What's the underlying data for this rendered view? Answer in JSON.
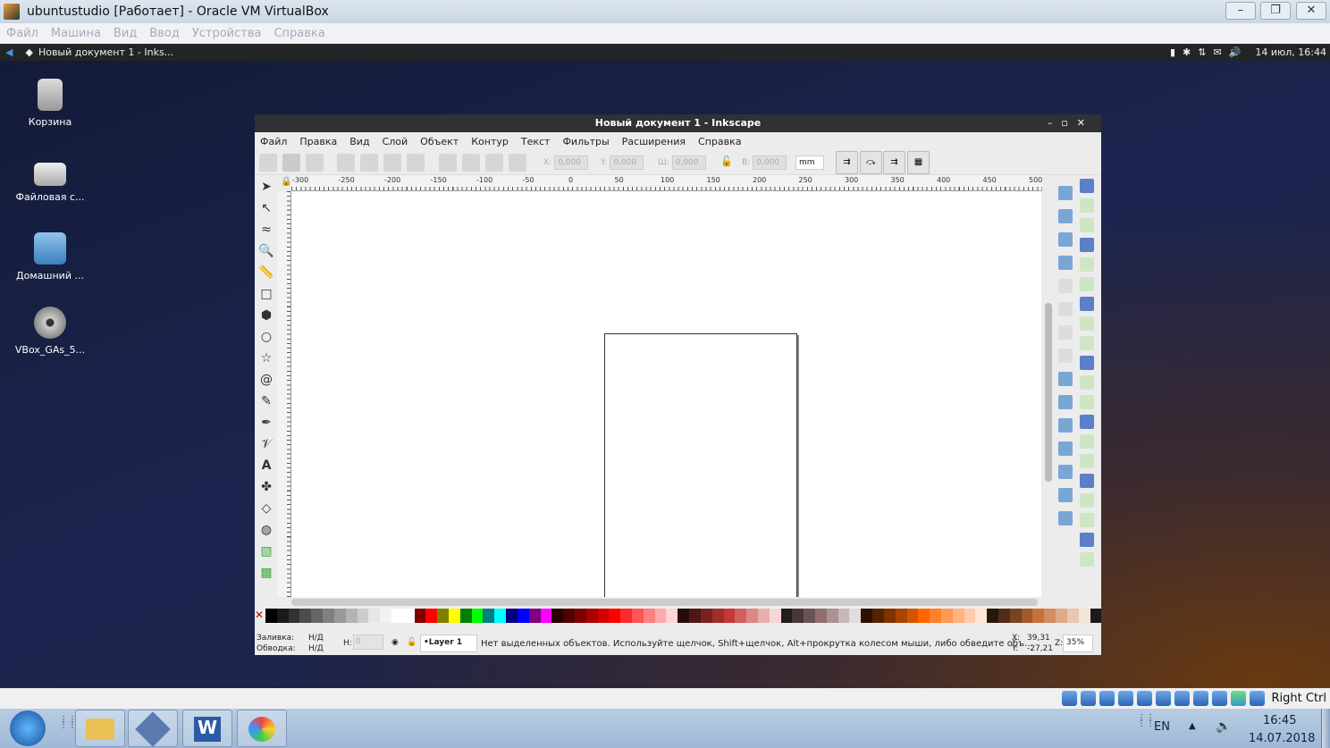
{
  "vbox": {
    "title": "ubuntustudio [Работает] - Oracle VM VirtualBox",
    "menu": [
      "Файл",
      "Машина",
      "Вид",
      "Ввод",
      "Устройства",
      "Справка"
    ],
    "status_hostkey": "Right Ctrl"
  },
  "panel": {
    "task": "Новый документ 1 - Inks...",
    "datetime": "14 июл, 16:44"
  },
  "desktop_icons": [
    {
      "label": "Корзина",
      "icon": "trash-icon"
    },
    {
      "label": "Файловая с...",
      "icon": "drive-icon"
    },
    {
      "label": "Домашний ...",
      "icon": "home-folder-icon"
    },
    {
      "label": "VBox_GAs_5...",
      "icon": "cd-icon"
    }
  ],
  "inkscape": {
    "title": "Новый документ 1 - Inkscape",
    "menu": [
      "Файл",
      "Правка",
      "Вид",
      "Слой",
      "Объект",
      "Контур",
      "Текст",
      "Фильтры",
      "Расширения",
      "Справка"
    ],
    "fields": {
      "x_label": "X:",
      "x": "0,000",
      "y_label": "Y:",
      "y": "0,000",
      "w_label": "Ш:",
      "w": "0,000",
      "h_label": "В:",
      "h": "0,000",
      "unit": "mm"
    },
    "ruler_labels": [
      "-300",
      "-250",
      "-200",
      "-150",
      "-100",
      "-50",
      "0",
      "50",
      "100",
      "150",
      "200",
      "250",
      "300",
      "350",
      "400",
      "450",
      "500"
    ],
    "status": {
      "fill_label": "Заливка:",
      "fill_value": "Н/Д",
      "stroke_label": "Обводка:",
      "stroke_value": "Н/Д",
      "opacity_label": "Н:",
      "opacity_value": "0",
      "layer": "•Layer 1",
      "message": "Нет выделенных объектов. Используйте щелчок, Shift+щелчок, Alt+прокрутка колесом мыши, либо обведите объ...",
      "x_label": "X:",
      "x": "39,31",
      "y_label": "Y:",
      "y": "-27,21",
      "zoom_label": "Z:",
      "zoom": "35%"
    },
    "palette": [
      "#000000",
      "#1a1a1a",
      "#333333",
      "#4d4d4d",
      "#666666",
      "#808080",
      "#999999",
      "#b3b3b3",
      "#cccccc",
      "#e6e6e6",
      "#f2f2f2",
      "#ffffff",
      "#ffffff",
      "#800000",
      "#ff0000",
      "#808000",
      "#ffff00",
      "#008000",
      "#00ff00",
      "#008080",
      "#00ffff",
      "#000080",
      "#0000ff",
      "#800080",
      "#ff00ff",
      "#2b0000",
      "#550000",
      "#800000",
      "#aa0000",
      "#d40000",
      "#ff0000",
      "#ff2a2a",
      "#ff5555",
      "#ff8080",
      "#ffaaaa",
      "#ffd5d5",
      "#280b0b",
      "#501616",
      "#782121",
      "#a02c2c",
      "#c83737",
      "#d35f5f",
      "#de8787",
      "#e9afaf",
      "#f4d7d7",
      "#241c1c",
      "#483737",
      "#6c5353",
      "#916f6f",
      "#ac9393",
      "#c8b7b7",
      "#e3dbdb",
      "#2b1100",
      "#552200",
      "#803300",
      "#aa4400",
      "#d45500",
      "#ff6600",
      "#ff7f2a",
      "#ff9955",
      "#ffb380",
      "#ffccaa",
      "#ffe6d5",
      "#28170b",
      "#502d16",
      "#784421",
      "#a05a2c",
      "#c87137",
      "#d38d5f",
      "#deaa87",
      "#e9c6af",
      "#f4e3d7",
      "#1a1a1a"
    ]
  },
  "taskbar": {
    "lang": "EN",
    "time": "16:45",
    "date": "14.07.2018"
  }
}
